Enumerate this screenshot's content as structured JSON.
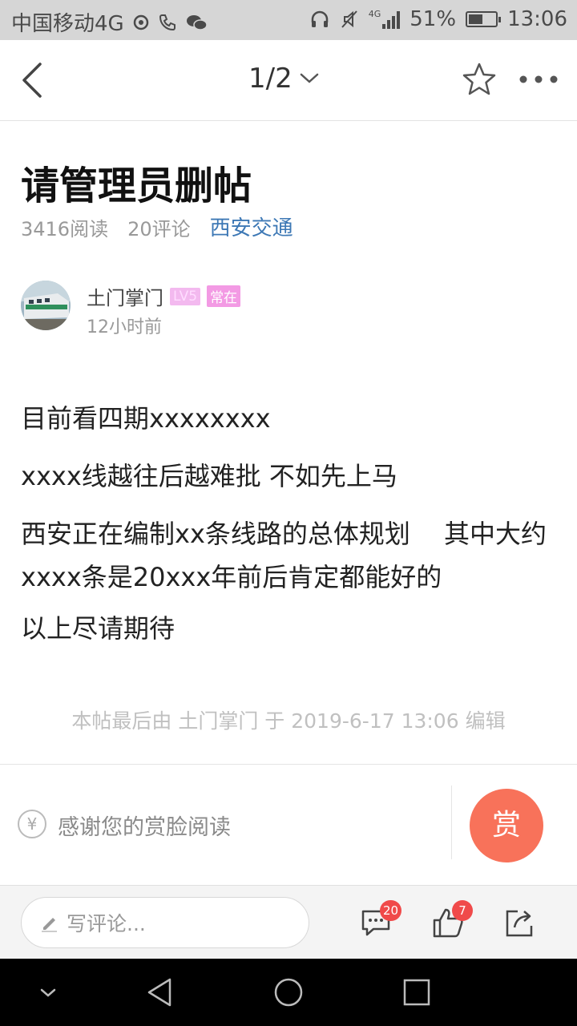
{
  "status_bar": {
    "carrier": "中国移动4G",
    "network": "4G",
    "battery": "51%",
    "battery_level": 0.51,
    "time": "13:06"
  },
  "header": {
    "page_indicator": "1/2",
    "back_icon": "chevron-left-icon",
    "favorite_icon": "star-icon",
    "more_icon": "more-dots-icon"
  },
  "post": {
    "title": "请管理员删帖",
    "reads": "3416阅读",
    "comments": "20评论",
    "forum": "西安交通",
    "author": {
      "name": "土门掌门",
      "level": "LV5",
      "badge": "常在",
      "time": "12小时前"
    },
    "paragraphs": [
      "目前看四期xxxxxxxx",
      "xxxx线越往后越难批 不如先上马",
      "西安正在编制xx条线路的总体规划　 其中大约xxxx条是20xxx年前后肯定都能好的",
      "以上尽请期待"
    ],
    "edit_note": "本帖最后由 土门掌门 于 2019-6-17 13:06 编辑"
  },
  "reward": {
    "text": "感谢您的赏脸阅读",
    "button": "赏",
    "currency_symbol": "¥"
  },
  "bottom_bar": {
    "comment_placeholder": "写评论...",
    "comment_count": "20",
    "like_count": "7"
  },
  "colors": {
    "forum_tag": "#3d78b5",
    "reward_button": "#f8725a",
    "count_badge": "#f04a4a"
  }
}
